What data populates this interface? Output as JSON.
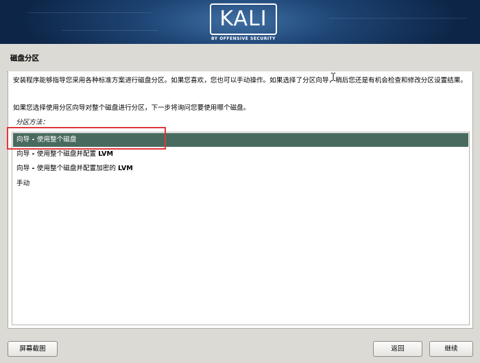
{
  "banner": {
    "logo_text": "KALI",
    "logo_subtitle": "BY OFFENSIVE SECURITY",
    "colors": {
      "dark": "#0d2547",
      "mid": "#1e4575",
      "light": "#3f6fa3"
    }
  },
  "page": {
    "title": "磁盘分区",
    "description": "安装程序能够指导您采用各种标准方案进行磁盘分区。如果您喜欢，您也可以手动操作。如果选择了分区向导，稍后您还是有机会检查和修改分区设置结果。",
    "question": "如果您选择使用分区向导对整个磁盘进行分区，下一步将询问您要使用哪个磁盘。",
    "method_label": "分区方法："
  },
  "options": [
    {
      "prefix": "向导",
      "dash": " - ",
      "text": "使用整个磁盘",
      "suffix": "",
      "selected": true
    },
    {
      "prefix": "向导",
      "dash": " - ",
      "text": "使用整个磁盘并配置 ",
      "suffix": "LVM",
      "selected": false
    },
    {
      "prefix": "向导",
      "dash": " - ",
      "text": "使用整个磁盘并配置加密的 ",
      "suffix": "LVM",
      "selected": false
    },
    {
      "prefix": "手动",
      "dash": "",
      "text": "",
      "suffix": "",
      "selected": false
    }
  ],
  "buttons": {
    "screenshot": "屏幕截图",
    "back": "返回",
    "continue": "继续"
  },
  "colors": {
    "selection": "#496a5f",
    "highlight_box": "#e0373a",
    "background": "#dcdad5"
  }
}
